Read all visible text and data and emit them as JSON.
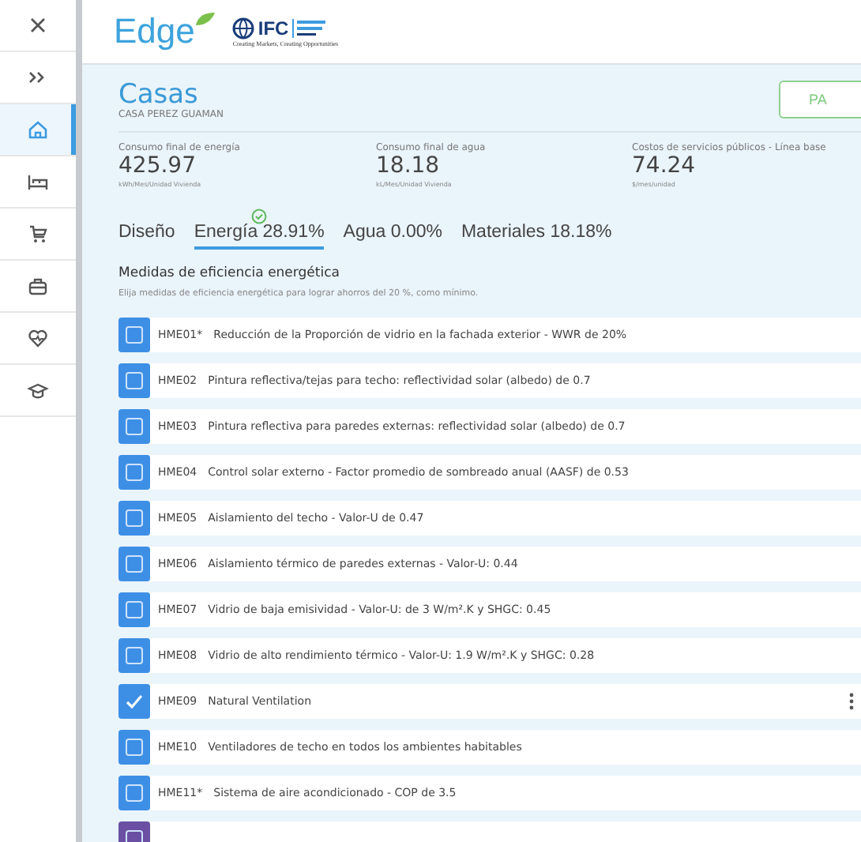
{
  "sidebar": {
    "items": [
      {
        "selected": false
      },
      {
        "selected": false
      },
      {
        "selected": true
      },
      {
        "selected": false
      },
      {
        "selected": false
      },
      {
        "selected": false
      },
      {
        "selected": false
      },
      {
        "selected": false
      }
    ]
  },
  "header": {
    "logo": "Edge",
    "partner": "IFC",
    "tagline": "Creating Markets, Creating Opportunities"
  },
  "project": {
    "title": "Casas",
    "subtitle": "CASA PEREZ GUAMAN",
    "button": "PA"
  },
  "metrics": [
    {
      "label": "Consumo final de energía",
      "value": "425.97",
      "unit": "kWh/Mes/Unidad Vivienda"
    },
    {
      "label": "Consumo final de agua",
      "value": "18.18",
      "unit": "kL/Mes/Unidad Vivienda"
    },
    {
      "label": "Costos de servicios públicos - Línea base",
      "value": "74.24",
      "unit": "$/mes/unidad"
    }
  ],
  "tabs": [
    {
      "label": "Diseño",
      "selected": false,
      "passed": false
    },
    {
      "label": "Energía 28.91%",
      "selected": true,
      "passed": true
    },
    {
      "label": "Agua 0.00%",
      "selected": false,
      "passed": false
    },
    {
      "label": "Materiales 18.18%",
      "selected": false,
      "passed": false
    }
  ],
  "section": {
    "heading": "Medidas de eficiencia energética",
    "description": "Elija medidas de eficiencia energética para lograr ahorros del 20 %, como mínimo."
  },
  "measures": [
    {
      "code": "HME01*",
      "text": "Reducción de la Proporción de vidrio en la fachada exterior - WWR de 20%",
      "checked": false,
      "menu": false,
      "color": "#3d8fe6"
    },
    {
      "code": "HME02",
      "text": "Pintura reflectiva/tejas para techo: reflectividad solar (albedo) de 0.7",
      "checked": false,
      "menu": false,
      "color": "#3d8fe6"
    },
    {
      "code": "HME03",
      "text": "Pintura reflectiva para paredes externas: reflectividad solar (albedo) de 0.7",
      "checked": false,
      "menu": false,
      "color": "#3d8fe6"
    },
    {
      "code": "HME04",
      "text": "Control solar externo - Factor promedio de sombreado anual (AASF) de 0.53",
      "checked": false,
      "menu": false,
      "color": "#3d8fe6"
    },
    {
      "code": "HME05",
      "text": "Aislamiento del techo - Valor-U de 0.47",
      "checked": false,
      "menu": false,
      "color": "#3d8fe6"
    },
    {
      "code": "HME06",
      "text": "Aislamiento térmico de paredes externas - Valor-U: 0.44",
      "checked": false,
      "menu": false,
      "color": "#3d8fe6"
    },
    {
      "code": "HME07",
      "text": "Vidrio de baja emisividad - Valor-U: de 3 W/m².K y SHGC: 0.45",
      "checked": false,
      "menu": false,
      "color": "#3d8fe6"
    },
    {
      "code": "HME08",
      "text": "Vidrio de alto rendimiento térmico - Valor-U: 1.9 W/m².K y SHGC: 0.28",
      "checked": false,
      "menu": false,
      "color": "#3d8fe6"
    },
    {
      "code": "HME09",
      "text": "Natural Ventilation",
      "checked": true,
      "menu": true,
      "color": "#3d8fe6"
    },
    {
      "code": "HME10",
      "text": "Ventiladores de techo en todos los ambientes habitables",
      "checked": false,
      "menu": false,
      "color": "#3d8fe6"
    },
    {
      "code": "HME11*",
      "text": "Sistema de aire acondicionado - COP de 3.5",
      "checked": false,
      "menu": false,
      "color": "#3d8fe6"
    },
    {
      "checked": false,
      "menu": false,
      "color": "#6a4fa3"
    }
  ]
}
